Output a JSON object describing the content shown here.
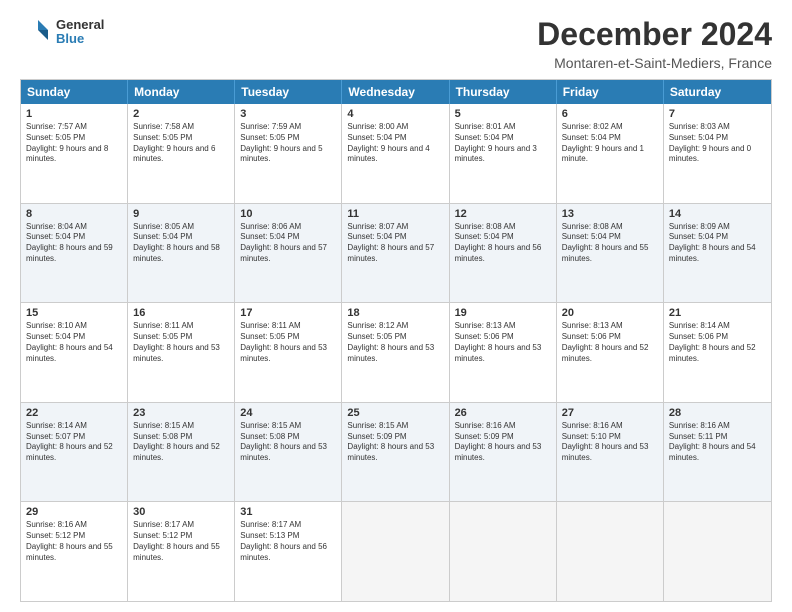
{
  "logo": {
    "line1": "General",
    "line2": "Blue"
  },
  "title": "December 2024",
  "subtitle": "Montaren-et-Saint-Mediers, France",
  "headers": [
    "Sunday",
    "Monday",
    "Tuesday",
    "Wednesday",
    "Thursday",
    "Friday",
    "Saturday"
  ],
  "weeks": [
    [
      {
        "day": "1",
        "sr": "7:57 AM",
        "ss": "5:05 PM",
        "dl": "9 hours and 8 minutes."
      },
      {
        "day": "2",
        "sr": "7:58 AM",
        "ss": "5:05 PM",
        "dl": "9 hours and 6 minutes."
      },
      {
        "day": "3",
        "sr": "7:59 AM",
        "ss": "5:05 PM",
        "dl": "9 hours and 5 minutes."
      },
      {
        "day": "4",
        "sr": "8:00 AM",
        "ss": "5:04 PM",
        "dl": "9 hours and 4 minutes."
      },
      {
        "day": "5",
        "sr": "8:01 AM",
        "ss": "5:04 PM",
        "dl": "9 hours and 3 minutes."
      },
      {
        "day": "6",
        "sr": "8:02 AM",
        "ss": "5:04 PM",
        "dl": "9 hours and 1 minute."
      },
      {
        "day": "7",
        "sr": "8:03 AM",
        "ss": "5:04 PM",
        "dl": "9 hours and 0 minutes."
      }
    ],
    [
      {
        "day": "8",
        "sr": "8:04 AM",
        "ss": "5:04 PM",
        "dl": "8 hours and 59 minutes."
      },
      {
        "day": "9",
        "sr": "8:05 AM",
        "ss": "5:04 PM",
        "dl": "8 hours and 58 minutes."
      },
      {
        "day": "10",
        "sr": "8:06 AM",
        "ss": "5:04 PM",
        "dl": "8 hours and 57 minutes."
      },
      {
        "day": "11",
        "sr": "8:07 AM",
        "ss": "5:04 PM",
        "dl": "8 hours and 57 minutes."
      },
      {
        "day": "12",
        "sr": "8:08 AM",
        "ss": "5:04 PM",
        "dl": "8 hours and 56 minutes."
      },
      {
        "day": "13",
        "sr": "8:08 AM",
        "ss": "5:04 PM",
        "dl": "8 hours and 55 minutes."
      },
      {
        "day": "14",
        "sr": "8:09 AM",
        "ss": "5:04 PM",
        "dl": "8 hours and 54 minutes."
      }
    ],
    [
      {
        "day": "15",
        "sr": "8:10 AM",
        "ss": "5:04 PM",
        "dl": "8 hours and 54 minutes."
      },
      {
        "day": "16",
        "sr": "8:11 AM",
        "ss": "5:05 PM",
        "dl": "8 hours and 53 minutes."
      },
      {
        "day": "17",
        "sr": "8:11 AM",
        "ss": "5:05 PM",
        "dl": "8 hours and 53 minutes."
      },
      {
        "day": "18",
        "sr": "8:12 AM",
        "ss": "5:05 PM",
        "dl": "8 hours and 53 minutes."
      },
      {
        "day": "19",
        "sr": "8:13 AM",
        "ss": "5:06 PM",
        "dl": "8 hours and 53 minutes."
      },
      {
        "day": "20",
        "sr": "8:13 AM",
        "ss": "5:06 PM",
        "dl": "8 hours and 52 minutes."
      },
      {
        "day": "21",
        "sr": "8:14 AM",
        "ss": "5:06 PM",
        "dl": "8 hours and 52 minutes."
      }
    ],
    [
      {
        "day": "22",
        "sr": "8:14 AM",
        "ss": "5:07 PM",
        "dl": "8 hours and 52 minutes."
      },
      {
        "day": "23",
        "sr": "8:15 AM",
        "ss": "5:08 PM",
        "dl": "8 hours and 52 minutes."
      },
      {
        "day": "24",
        "sr": "8:15 AM",
        "ss": "5:08 PM",
        "dl": "8 hours and 53 minutes."
      },
      {
        "day": "25",
        "sr": "8:15 AM",
        "ss": "5:09 PM",
        "dl": "8 hours and 53 minutes."
      },
      {
        "day": "26",
        "sr": "8:16 AM",
        "ss": "5:09 PM",
        "dl": "8 hours and 53 minutes."
      },
      {
        "day": "27",
        "sr": "8:16 AM",
        "ss": "5:10 PM",
        "dl": "8 hours and 53 minutes."
      },
      {
        "day": "28",
        "sr": "8:16 AM",
        "ss": "5:11 PM",
        "dl": "8 hours and 54 minutes."
      }
    ],
    [
      {
        "day": "29",
        "sr": "8:16 AM",
        "ss": "5:12 PM",
        "dl": "8 hours and 55 minutes."
      },
      {
        "day": "30",
        "sr": "8:17 AM",
        "ss": "5:12 PM",
        "dl": "8 hours and 55 minutes."
      },
      {
        "day": "31",
        "sr": "8:17 AM",
        "ss": "5:13 PM",
        "dl": "8 hours and 56 minutes."
      },
      null,
      null,
      null,
      null
    ]
  ]
}
